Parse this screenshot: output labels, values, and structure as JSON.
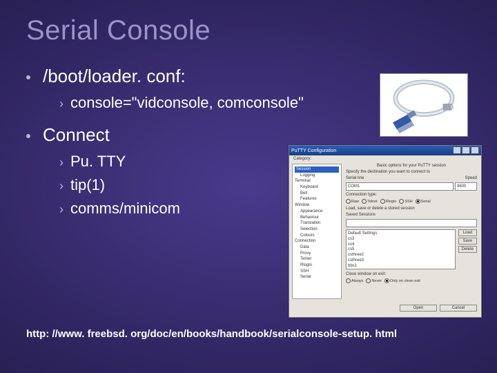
{
  "title": "Serial Console",
  "bullets": [
    {
      "text": "/boot/loader. conf:",
      "subs": [
        "console=\"vidconsole, comconsole\""
      ]
    },
    {
      "text": "Connect",
      "subs": [
        "Pu. TTY",
        "tip(1)",
        "comms/minicom"
      ]
    }
  ],
  "footer": "http: //www. freebsd. org/doc/en/books/handbook/serialconsole-setup. html",
  "putty": {
    "title": "PuTTY Configuration",
    "cat_label": "Category:",
    "tree": [
      "Session",
      "  Logging",
      "Terminal",
      "  Keyboard",
      "  Bell",
      "  Features",
      "Window",
      "  Appearance",
      "  Behaviour",
      "  Translation",
      "  Selection",
      "  Colours",
      "Connection",
      "  Data",
      "  Proxy",
      "  Telnet",
      "  Rlogin",
      "  SSH",
      "  Serial"
    ],
    "basic": "Basic options for your PuTTY session",
    "dest": "Specify the destination you want to connect to",
    "serial": "Serial line",
    "serial_val": "COM1",
    "speed": "Speed",
    "speed_val": "9600",
    "ctype": "Connection type:",
    "radios": [
      "Raw",
      "Telnet",
      "Rlogin",
      "SSH",
      "Serial"
    ],
    "lss": "Load, save or delete a stored session",
    "saved": "Saved Sessions",
    "list": [
      "Default Settings",
      "cs3",
      "cs4",
      "cs5",
      "csthree2",
      "csthree3",
      "bbs1"
    ],
    "btns": [
      "Load",
      "Save",
      "Delete"
    ],
    "close": "Close window on exit:",
    "close_opts": [
      "Always",
      "Never",
      "Only on clean exit"
    ],
    "footer_btns": [
      "Open",
      "Cancel"
    ]
  }
}
